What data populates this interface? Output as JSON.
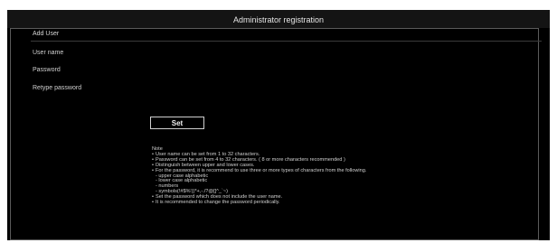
{
  "title": "Administrator registration",
  "section": "Add User",
  "fields": [
    {
      "label": "User name"
    },
    {
      "label": "Password"
    },
    {
      "label": "Retype password"
    }
  ],
  "set_button": "Set",
  "note": {
    "title": "Note",
    "lines": [
      {
        "text": "User name can be set from 1 to 32 characters.",
        "bullet": true
      },
      {
        "text": "Password can be set from 4 to 32 characters. ( 8 or more characters recommended )",
        "bullet": true
      },
      {
        "text": "Distinguish between upper and lower cases.",
        "bullet": true
      },
      {
        "text": "For the password, it is  recommend to use three or more types of characters from the following.",
        "bullet": true
      },
      {
        "text": "- upper case alphabetic",
        "bullet": false
      },
      {
        "text": "- lower case alphabetic",
        "bullet": false
      },
      {
        "text": "- numbers",
        "bullet": false
      },
      {
        "text": "- symbols(!#$%'()*+,-./?@[]^_`~)",
        "bullet": false
      },
      {
        "text": "Set the password which does not include the user name.",
        "bullet": true
      },
      {
        "text": "It is recommended to change the password periodically.",
        "bullet": true
      }
    ]
  }
}
